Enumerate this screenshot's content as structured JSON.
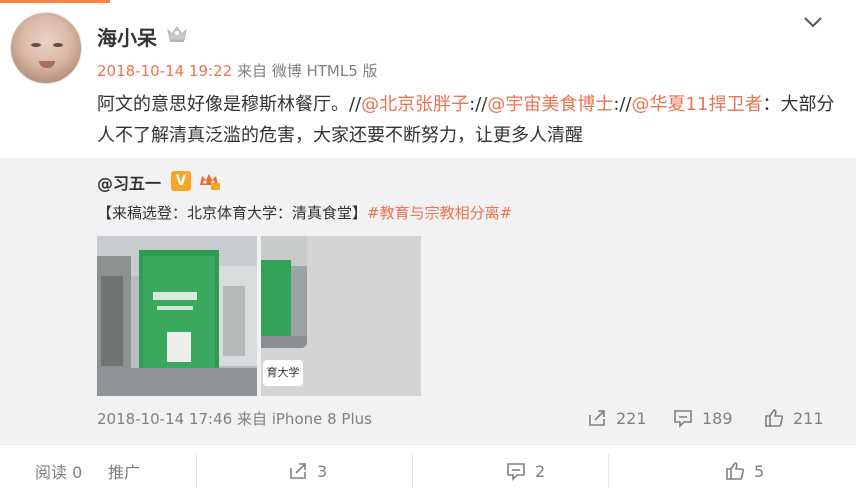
{
  "post": {
    "username": "海小呆",
    "timestamp": "2018-10-14 19:22",
    "source": "来自 微博 HTML5 版",
    "text_segments": [
      {
        "text": "阿文的意思好像是穆斯林餐厅。//",
        "type": "plain"
      },
      {
        "text": "@北京张胖子",
        "type": "mention"
      },
      {
        "text": "://",
        "type": "plain"
      },
      {
        "text": "@宇宙美食博士",
        "type": "mention"
      },
      {
        "text": "://",
        "type": "plain"
      },
      {
        "text": "@华夏11捍卫者",
        "type": "mention"
      },
      {
        "text": "：大部分人不了解清真泛滥的危害，大家还要不断努力，让更多人清醒",
        "type": "plain"
      }
    ]
  },
  "repost": {
    "author": "@习五一",
    "verified_badge": "V",
    "text_plain": "【来稿选登：北京体育大学：清真食堂】",
    "text_topic": "#教育与宗教相分离#",
    "photo2_label": "育大学",
    "footer_time": "2018-10-14 17:46",
    "footer_source": "来自 iPhone 8 Plus",
    "share_count": "221",
    "comment_count": "189",
    "like_count": "211"
  },
  "bottom_bar": {
    "read_label": "阅读 0",
    "promote_label": "推广",
    "share_count": "3",
    "comment_count": "2",
    "like_count": "5"
  },
  "icons": {
    "crown": "crown-icon",
    "chevron": "chevron-down-icon",
    "share": "share-icon",
    "comment": "comment-icon",
    "like": "like-icon"
  },
  "colors": {
    "accent": "#eb7350",
    "muted": "#808080",
    "repost_bg": "#f2f2f5",
    "verified": "#f6a524"
  }
}
